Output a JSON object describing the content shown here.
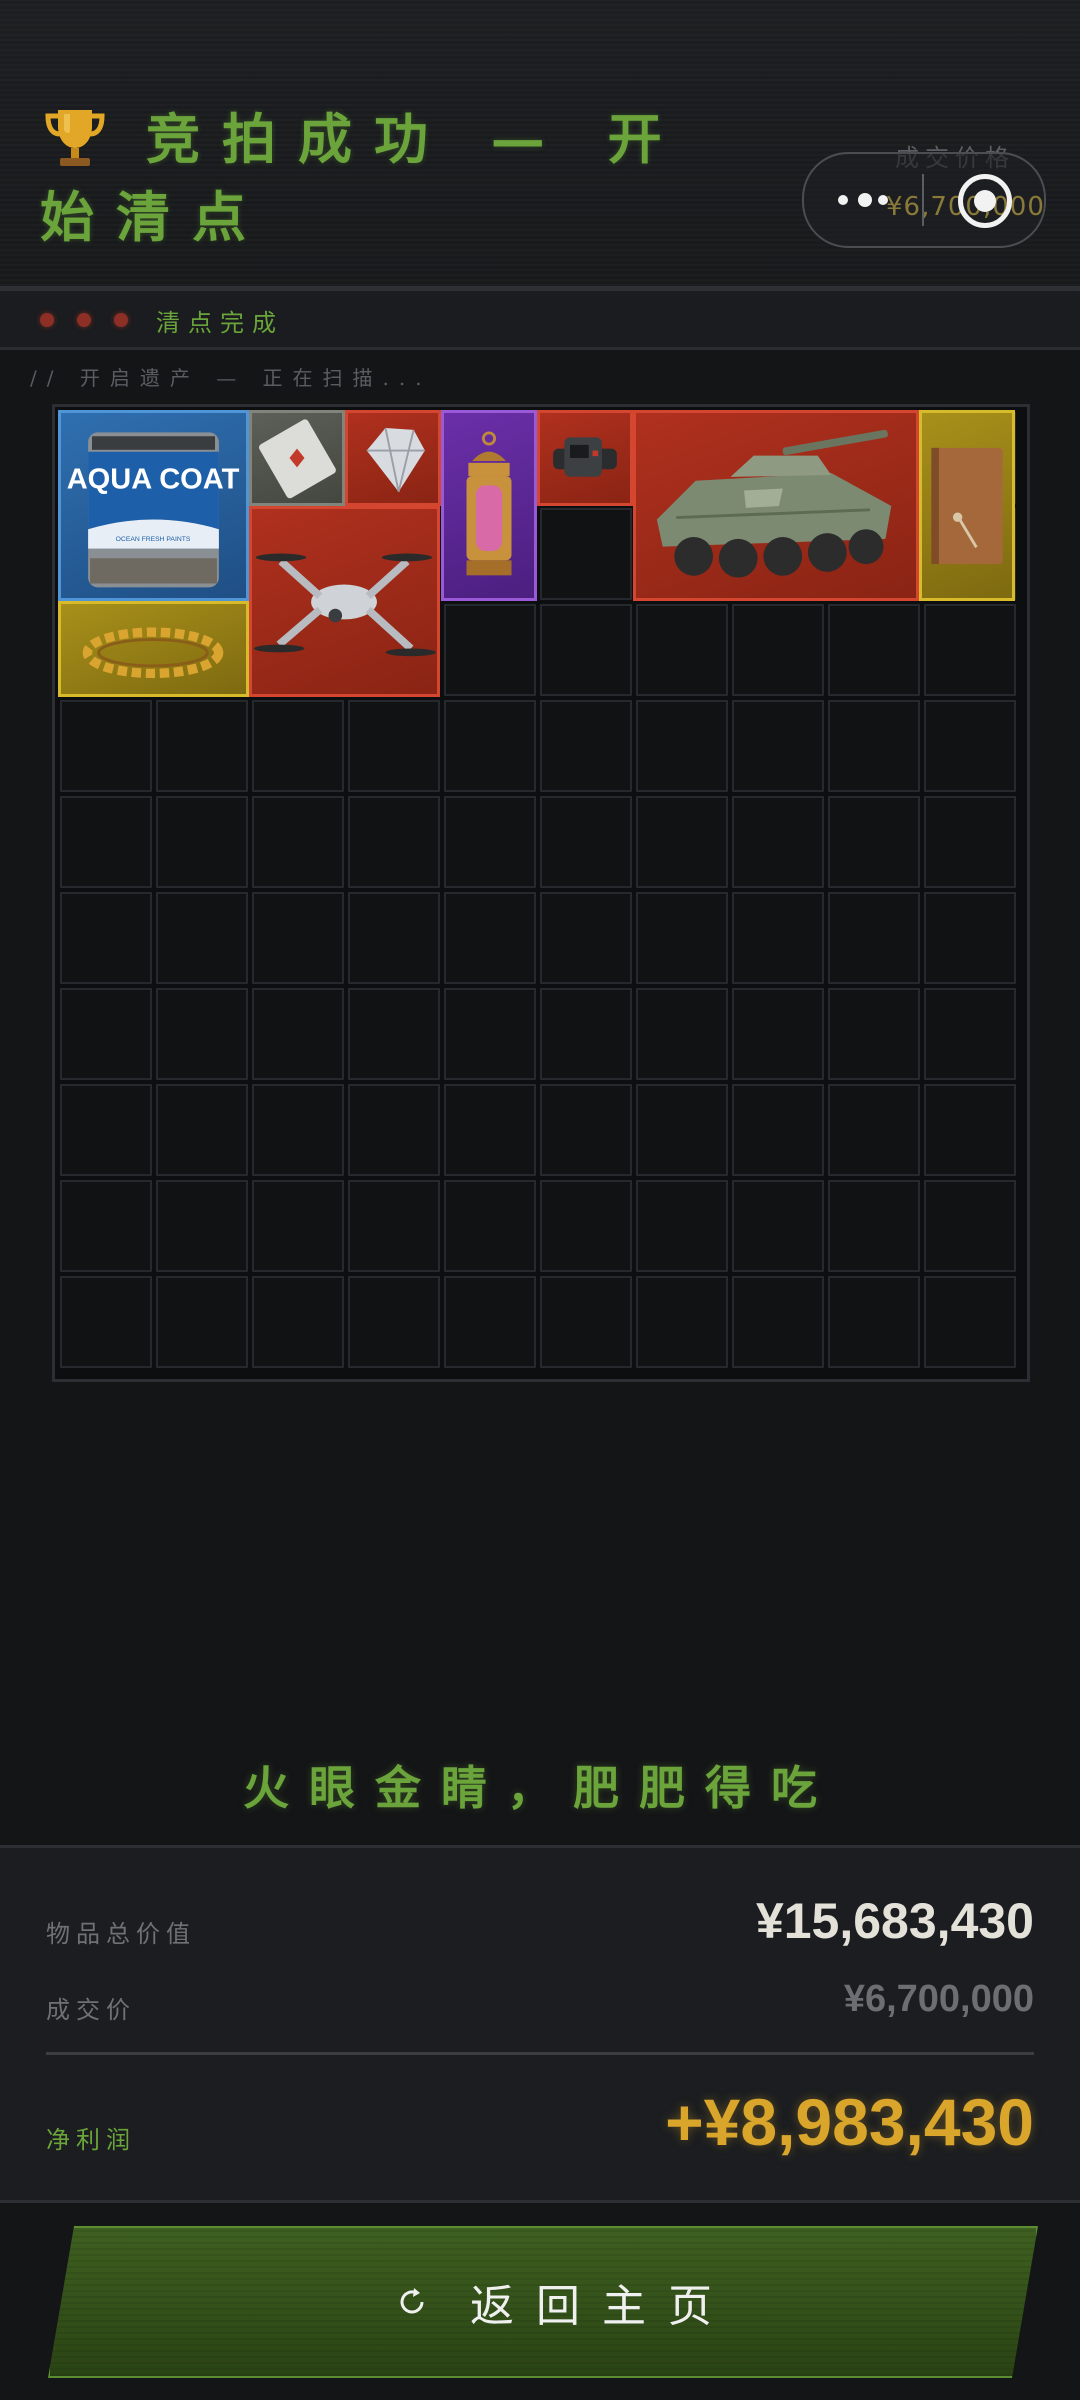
{
  "header": {
    "title": "竞拍成功 — 开始清点",
    "price_ghost_label": "成交价格",
    "capsule_price": "¥6,700,000"
  },
  "status": {
    "text": "清点完成"
  },
  "scan_text": "// 开启遗产 — 正在扫描...",
  "inventory": {
    "columns": 10,
    "rows": 10,
    "items": [
      {
        "name": "paint-bucket",
        "label": "AQUA COAT",
        "sublabel": "OCEAN FRESH PAINTS",
        "rarity": "blue"
      },
      {
        "name": "playing-card",
        "rarity": "gray"
      },
      {
        "name": "diamond",
        "rarity": "red"
      },
      {
        "name": "lantern",
        "rarity": "purple"
      },
      {
        "name": "tactical-watch",
        "rarity": "red"
      },
      {
        "name": "armored-vehicle",
        "rarity": "red"
      },
      {
        "name": "notebook",
        "rarity": "gold"
      },
      {
        "name": "gold-laurel-crown",
        "rarity": "gold"
      },
      {
        "name": "drone",
        "rarity": "red"
      }
    ]
  },
  "slogan": "火眼金睛，肥肥得吃",
  "summary": {
    "total_label": "物品总价值",
    "total_value": "¥15,683,430",
    "deal_label": "成交价",
    "deal_value": "¥6,700,000",
    "profit_label": "净利润",
    "profit_value": "+¥8,983,430"
  },
  "home_button": {
    "label": "返回主页"
  },
  "colors": {
    "accent_green": "#6aa43a",
    "profit_gold": "#d9a52b",
    "rarity_red": "#b0301e",
    "rarity_blue": "#2f6fb0",
    "rarity_gold": "#a8901a",
    "rarity_purple": "#6a2fa8"
  }
}
